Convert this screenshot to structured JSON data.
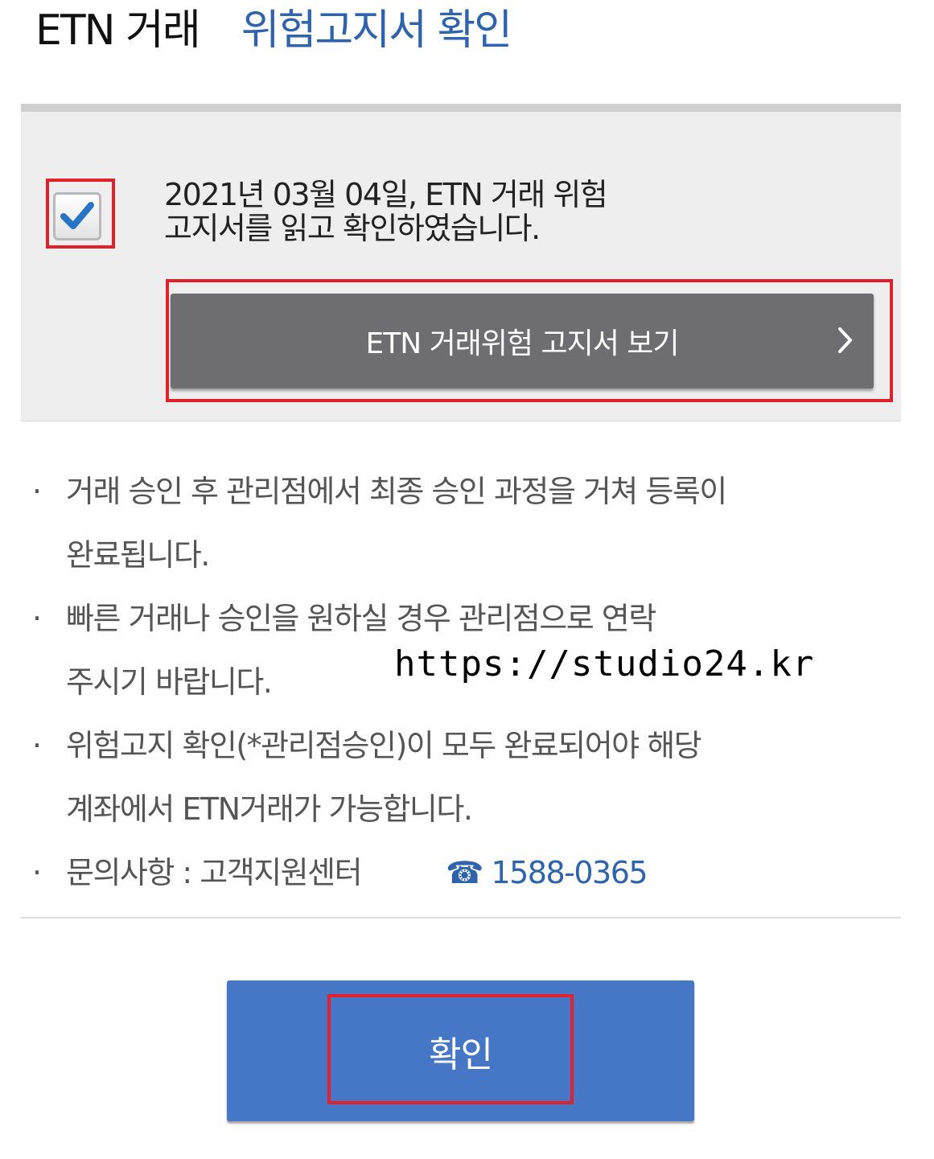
{
  "header": {
    "title_main": "ETN 거래",
    "title_sub": "위험고지서 확인"
  },
  "agreement": {
    "checked": true,
    "text_line1": "2021년 03월 04일, ETN 거래 위험",
    "text_line2": "고지서를 읽고 확인하였습니다.",
    "view_button_label": "ETN 거래위험 고지서 보기"
  },
  "notes": [
    {
      "line1": "거래 승인 후 관리점에서 최종 승인 과정을 거쳐 등록이",
      "line2": "완료됩니다."
    },
    {
      "line1": "빠른 거래나 승인을 원하실 경우 관리점으로 연락",
      "line2": "주시기 바랍니다."
    },
    {
      "line1": "위험고지 확인(*관리점승인)이 모두 완료되어야 해당",
      "line2": "계좌에서 ETN거래가 가능합니다."
    }
  ],
  "contact": {
    "label": "문의사항 : 고객지원센터",
    "phone_icon": "☎",
    "phone": "1588-0365"
  },
  "watermark": "https://studio24.kr",
  "confirm_label": "확인",
  "colors": {
    "accent_blue": "#2f63ac",
    "confirm_button": "#4577c6",
    "view_button": "#6e6e72",
    "highlight_red": "#e0202a"
  }
}
